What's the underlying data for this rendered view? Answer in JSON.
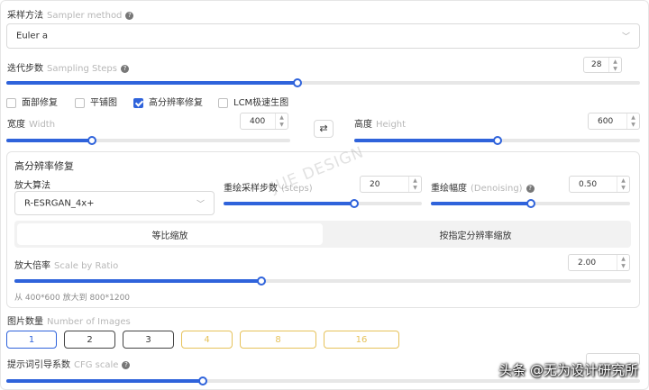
{
  "sampler": {
    "label": "采样方法",
    "label_en": "Sampler method",
    "value": "Euler a"
  },
  "steps": {
    "label": "迭代步数",
    "label_en": "Sampling Steps",
    "value": "28",
    "fraction": 0.46
  },
  "options": [
    {
      "label": "面部修复",
      "checked": false
    },
    {
      "label": "平铺图",
      "checked": false
    },
    {
      "label": "高分辨率修复",
      "checked": true
    },
    {
      "label": "LCM极速生图",
      "checked": false
    }
  ],
  "width": {
    "label": "宽度",
    "label_en": "Width",
    "value": "400",
    "fraction": 0.3
  },
  "height": {
    "label": "高度",
    "label_en": "Height",
    "value": "600",
    "fraction": 0.5
  },
  "swap_icon": "⇄",
  "hires": {
    "title": "高分辨率修复",
    "upscaler": {
      "label": "放大算法",
      "value": "R-ESRGAN_4x+"
    },
    "hires_steps": {
      "label": "重绘采样步数",
      "label_en": "(steps)",
      "value": "20",
      "fraction": 0.66
    },
    "denoising": {
      "label": "重绘幅度",
      "label_en": "(Denoising)",
      "value": "0.50",
      "fraction": 0.5
    },
    "modes": [
      "等比缩放",
      "按指定分辨率缩放"
    ],
    "scale": {
      "label": "放大倍率",
      "label_en": "Scale by Ratio",
      "value": "2.00",
      "fraction": 0.4
    },
    "note": "从 400*600 放大到 800*1200"
  },
  "images": {
    "label": "图片数量",
    "label_en": "Number of Images",
    "counts": [
      "1",
      "2",
      "3",
      "4",
      "8",
      "16"
    ]
  },
  "cfg": {
    "label": "提示词引导系数",
    "label_en": "CFG scale",
    "fraction": 0.31
  },
  "watermark": "JUE DESIGN",
  "credit": "头条 @无为设计研究所",
  "colors": {
    "accent": "#2f63db",
    "gold": "#e6c25a"
  }
}
